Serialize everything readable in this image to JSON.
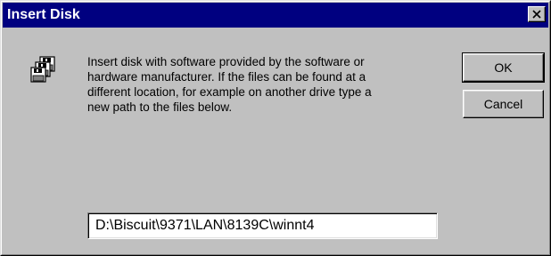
{
  "window": {
    "title": "Insert Disk",
    "close_icon": "close-x-icon"
  },
  "message": {
    "icon": "floppy-disks-icon",
    "text": "Insert disk with software provided by the software or\nhardware manufacturer.  If the files can be found at a\ndifferent location, for example on another drive type a\nnew path to the files below."
  },
  "buttons": {
    "ok_label": "OK",
    "cancel_label": "Cancel"
  },
  "path_field": {
    "value": "D:\\Biscuit\\9371\\LAN\\8139C\\winnt4"
  },
  "colors": {
    "title_bar": "#000080",
    "dialog_face": "#c0c0c0"
  }
}
